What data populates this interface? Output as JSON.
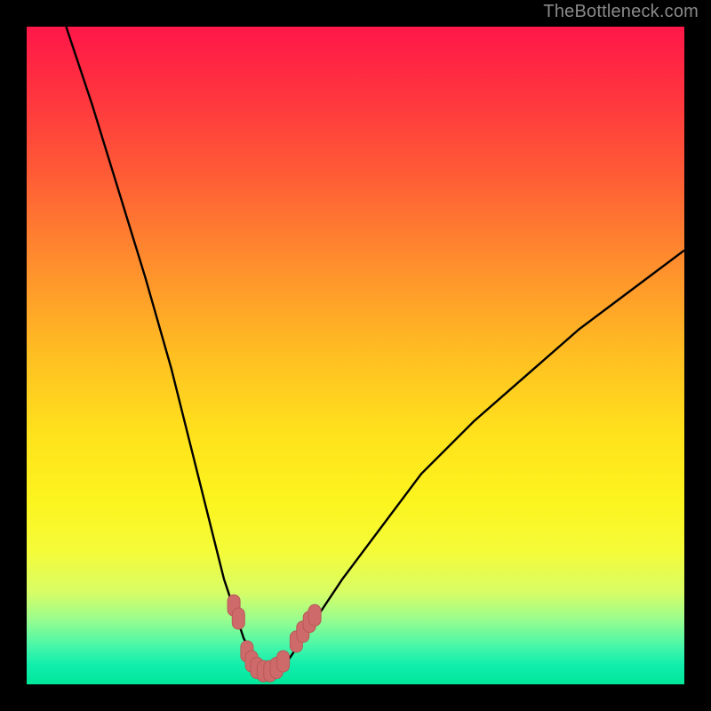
{
  "watermark": "TheBottleneck.com",
  "colors": {
    "frame": "#000000",
    "curve_stroke": "#000000",
    "marker_fill": "#cf6a6a",
    "marker_stroke": "#b95858",
    "gradient": [
      {
        "offset": 0.0,
        "color": "#ff1749"
      },
      {
        "offset": 0.1,
        "color": "#ff333f"
      },
      {
        "offset": 0.22,
        "color": "#ff5a36"
      },
      {
        "offset": 0.35,
        "color": "#ff8a2e"
      },
      {
        "offset": 0.5,
        "color": "#ffbf22"
      },
      {
        "offset": 0.62,
        "color": "#ffe21c"
      },
      {
        "offset": 0.72,
        "color": "#fcf41e"
      },
      {
        "offset": 0.8,
        "color": "#f4fc3a"
      },
      {
        "offset": 0.86,
        "color": "#d7fd66"
      },
      {
        "offset": 0.9,
        "color": "#9cfd8d"
      },
      {
        "offset": 0.94,
        "color": "#4bf7a8"
      },
      {
        "offset": 0.97,
        "color": "#12eead"
      },
      {
        "offset": 1.0,
        "color": "#00e79a"
      }
    ]
  },
  "chart_data": {
    "type": "line",
    "title": "",
    "xlabel": "",
    "ylabel": "",
    "xlim": [
      0,
      100
    ],
    "ylim": [
      0,
      100
    ],
    "series": [
      {
        "name": "bottleneck-curve",
        "x": [
          6,
          10,
          14,
          18,
          22,
          26,
          28,
          30,
          32,
          33,
          34,
          35,
          36,
          37,
          38,
          39,
          40,
          42,
          44,
          48,
          54,
          60,
          68,
          76,
          84,
          92,
          100
        ],
        "y": [
          100,
          88,
          75,
          62,
          48,
          32,
          24,
          16,
          10,
          7,
          5,
          3,
          2,
          2,
          2,
          3,
          4,
          7,
          10,
          16,
          24,
          32,
          40,
          47,
          54,
          60,
          66
        ]
      }
    ],
    "optimal_markers": {
      "name": "optimal-range",
      "points": [
        {
          "x": 31.5,
          "y": 12
        },
        {
          "x": 32.2,
          "y": 10
        },
        {
          "x": 33.5,
          "y": 5
        },
        {
          "x": 34.2,
          "y": 3.5
        },
        {
          "x": 35.0,
          "y": 2.5
        },
        {
          "x": 36.0,
          "y": 2.0
        },
        {
          "x": 37.0,
          "y": 2.0
        },
        {
          "x": 38.0,
          "y": 2.5
        },
        {
          "x": 39.0,
          "y": 3.5
        },
        {
          "x": 41.0,
          "y": 6.5
        },
        {
          "x": 42.0,
          "y": 8.0
        },
        {
          "x": 43.0,
          "y": 9.5
        },
        {
          "x": 43.8,
          "y": 10.5
        }
      ]
    }
  }
}
